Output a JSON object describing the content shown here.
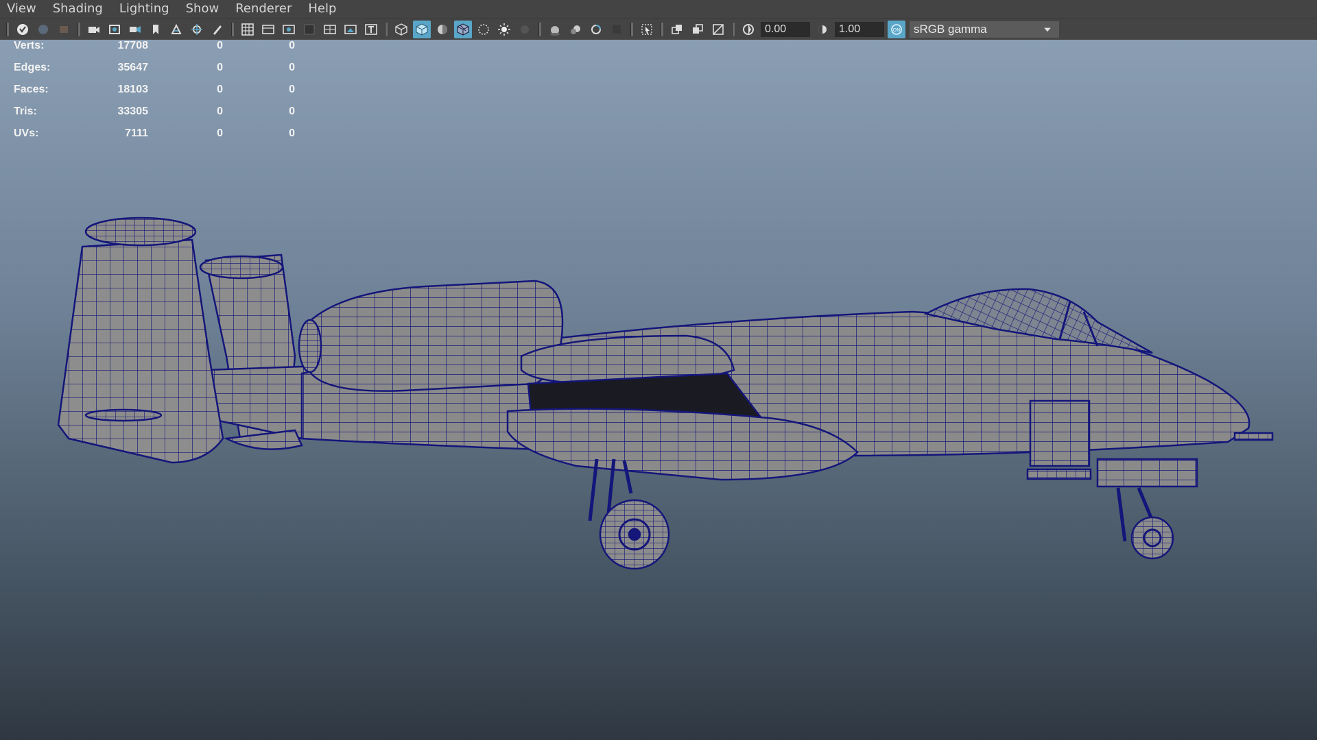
{
  "menu": [
    "View",
    "Shading",
    "Lighting",
    "Show",
    "Renderer",
    "Help"
  ],
  "toolbar": {
    "gamma_value": "0.00",
    "exposure_value": "1.00",
    "color_space": "sRGB gamma",
    "accent_color": "#5aa6c8"
  },
  "hud": {
    "rows": [
      {
        "label": "Verts:",
        "v1": "17708",
        "v2": "0",
        "v3": "0"
      },
      {
        "label": "Edges:",
        "v1": "35647",
        "v2": "0",
        "v3": "0"
      },
      {
        "label": "Faces:",
        "v1": "18103",
        "v2": "0",
        "v3": "0"
      },
      {
        "label": "Tris:",
        "v1": "33305",
        "v2": "0",
        "v3": "0"
      },
      {
        "label": "UVs:",
        "v1": "7111",
        "v2": "0",
        "v3": "0"
      }
    ]
  },
  "icons": [
    "select-icon",
    "camera-icon",
    "grid-icon",
    "wireframe-cube-icon",
    "smooth-shade-icon",
    "light-icon",
    "isolate-icon",
    "exposure-icon",
    "gamma-icon",
    "color-management-icon",
    "dropdown-arrow-icon"
  ],
  "viewport": {
    "wire_color": "#14167a",
    "surface_color": "#8a8a8a"
  }
}
